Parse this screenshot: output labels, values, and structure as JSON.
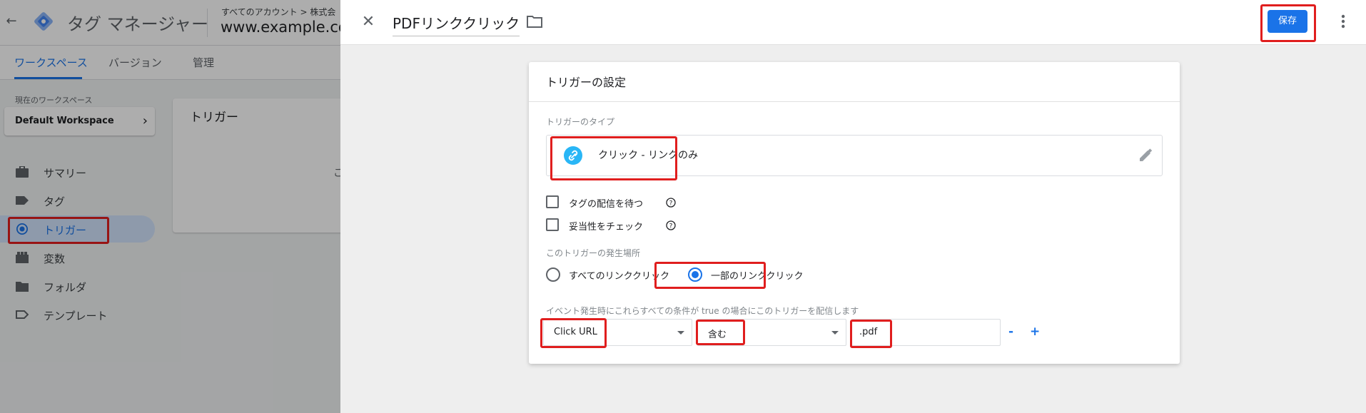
{
  "app": {
    "title": "タグ マネージャー",
    "account_crumb": "すべてのアカウント > 株式会",
    "container_name": "www.example.co"
  },
  "nav_tabs": [
    {
      "label": "ワークスペース",
      "active": true
    },
    {
      "label": "バージョン",
      "active": false
    },
    {
      "label": "管理",
      "active": false
    }
  ],
  "workspace": {
    "label": "現在のワークスペース",
    "name": "Default Workspace"
  },
  "sidebar": {
    "items": [
      {
        "label": "サマリー",
        "icon": "briefcase-icon"
      },
      {
        "label": "タグ",
        "icon": "tag-icon"
      },
      {
        "label": "トリガー",
        "icon": "trigger-icon",
        "active": true
      },
      {
        "label": "変数",
        "icon": "variables-icon"
      },
      {
        "label": "フォルダ",
        "icon": "folder-icon"
      },
      {
        "label": "テンプレート",
        "icon": "template-icon"
      }
    ]
  },
  "background_card": {
    "title": "トリガー",
    "text": "こ"
  },
  "panel": {
    "trigger_name": "PDFリンククリック",
    "save_label": "保存",
    "card_title": "トリガーの設定",
    "type_label": "トリガーのタイプ",
    "type_name": "クリック - リンクのみ",
    "checkbox_wait": "タグの配信を待つ",
    "checkbox_validate": "妥当性をチェック",
    "fire_on_label": "このトリガーの発生場所",
    "radio_all": "すべてのリンククリック",
    "radio_some": "一部のリンククリック",
    "conditions_label": "イベント発生時にこれらすべての条件が true の場合にこのトリガーを配信します",
    "condition": {
      "variable": "Click URL",
      "operator": "含む",
      "value": ".pdf"
    },
    "remove_label": "-",
    "add_label": "+"
  },
  "colors": {
    "accent": "#1a73e8",
    "highlight": "#e01e1e",
    "link_icon": "#29b6f6"
  }
}
